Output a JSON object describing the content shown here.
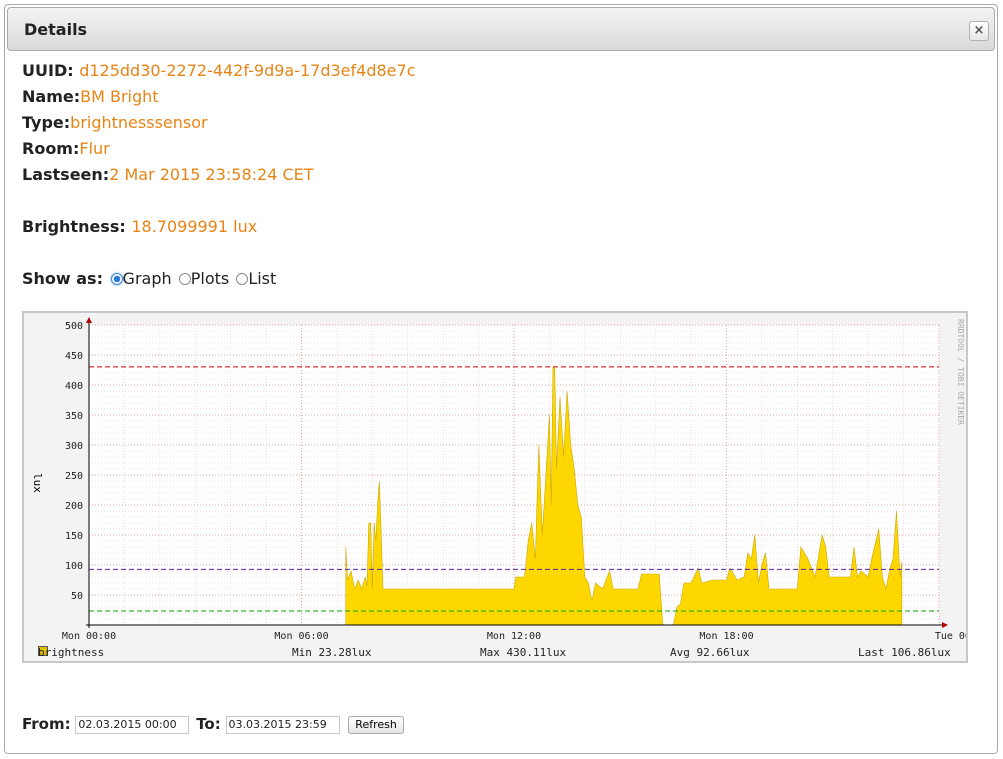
{
  "dialog": {
    "title": "Details",
    "close_label": "×"
  },
  "fields": [
    {
      "label": "UUID: ",
      "value": "d125dd30-2272-442f-9d9a-17d3ef4d8e7c"
    },
    {
      "label": "Name:",
      "value": "BM Bright"
    },
    {
      "label": "Type:",
      "value": "brightnesssensor"
    },
    {
      "label": "Room:",
      "value": "Flur"
    },
    {
      "label": "Lastseen:",
      "value": "2 Mar 2015 23:58:24 CET"
    }
  ],
  "brightness": {
    "label": "Brightness: ",
    "value": "18.7099991 lux"
  },
  "show_as": {
    "label": "Show as: ",
    "options": [
      "Graph",
      "Plots",
      "List"
    ],
    "selected": "Graph"
  },
  "colors": {
    "accent": "#e88415",
    "area": "#ffd700",
    "max_line": "#cc0000",
    "avg_line": "#5522aa",
    "min_line": "#00aa00"
  },
  "chart_data": {
    "type": "area",
    "ylabel": "lux",
    "watermark": "RRDTOOL / TOBI OETIKER",
    "ylim": [
      0,
      500
    ],
    "yticks": [
      50,
      100,
      150,
      200,
      250,
      300,
      350,
      400,
      450,
      500
    ],
    "xlim": [
      0,
      24
    ],
    "xticks": [
      {
        "x": 0,
        "label": "Mon 00:00"
      },
      {
        "x": 6,
        "label": "Mon 06:00"
      },
      {
        "x": 12,
        "label": "Mon 12:00"
      },
      {
        "x": 18,
        "label": "Mon 18:00"
      },
      {
        "x": 24,
        "label": "Tue 00:00"
      }
    ],
    "hlines": {
      "max": 430.11,
      "avg": 92.66,
      "min": 23.28
    },
    "legend": {
      "series": "brightness",
      "min": "Min  23.28lux",
      "max": "Max 430.11lux",
      "avg": "Avg  92.66lux",
      "last": "Last 106.86lux"
    },
    "series": [
      {
        "name": "brightness",
        "points": [
          [
            0,
            0
          ],
          [
            7.25,
            0
          ],
          [
            7.25,
            130
          ],
          [
            7.3,
            75
          ],
          [
            7.4,
            90
          ],
          [
            7.5,
            60
          ],
          [
            7.6,
            75
          ],
          [
            7.7,
            60
          ],
          [
            7.8,
            80
          ],
          [
            7.85,
            65
          ],
          [
            7.9,
            170
          ],
          [
            7.95,
            170
          ],
          [
            8.0,
            60
          ],
          [
            8.05,
            170
          ],
          [
            8.1,
            140
          ],
          [
            8.15,
            200
          ],
          [
            8.2,
            240
          ],
          [
            8.25,
            150
          ],
          [
            8.3,
            60
          ],
          [
            9.0,
            60
          ],
          [
            10.5,
            60
          ],
          [
            12.0,
            60
          ],
          [
            12.05,
            80
          ],
          [
            12.3,
            80
          ],
          [
            12.4,
            140
          ],
          [
            12.5,
            170
          ],
          [
            12.6,
            110
          ],
          [
            12.7,
            300
          ],
          [
            12.8,
            150
          ],
          [
            12.9,
            250
          ],
          [
            13.0,
            350
          ],
          [
            13.05,
            200
          ],
          [
            13.1,
            430
          ],
          [
            13.15,
            430
          ],
          [
            13.2,
            260
          ],
          [
            13.3,
            380
          ],
          [
            13.4,
            280
          ],
          [
            13.5,
            390
          ],
          [
            13.6,
            300
          ],
          [
            13.7,
            260
          ],
          [
            13.8,
            200
          ],
          [
            13.9,
            180
          ],
          [
            14.0,
            80
          ],
          [
            14.1,
            70
          ],
          [
            14.2,
            40
          ],
          [
            14.3,
            70
          ],
          [
            14.5,
            60
          ],
          [
            14.6,
            75
          ],
          [
            14.7,
            90
          ],
          [
            14.8,
            60
          ],
          [
            15.0,
            60
          ],
          [
            15.5,
            60
          ],
          [
            15.6,
            85
          ],
          [
            16.0,
            85
          ],
          [
            16.1,
            85
          ],
          [
            16.2,
            0
          ],
          [
            16.5,
            0
          ],
          [
            16.6,
            30
          ],
          [
            16.7,
            35
          ],
          [
            16.8,
            70
          ],
          [
            17.0,
            70
          ],
          [
            17.2,
            95
          ],
          [
            17.3,
            70
          ],
          [
            17.6,
            75
          ],
          [
            18.0,
            75
          ],
          [
            18.1,
            95
          ],
          [
            18.3,
            75
          ],
          [
            18.5,
            80
          ],
          [
            18.6,
            120
          ],
          [
            18.7,
            110
          ],
          [
            18.8,
            150
          ],
          [
            18.9,
            70
          ],
          [
            19.0,
            100
          ],
          [
            19.1,
            120
          ],
          [
            19.2,
            60
          ],
          [
            19.5,
            60
          ],
          [
            19.8,
            60
          ],
          [
            20.0,
            60
          ],
          [
            20.1,
            130
          ],
          [
            20.3,
            110
          ],
          [
            20.5,
            80
          ],
          [
            20.7,
            150
          ],
          [
            20.8,
            130
          ],
          [
            20.9,
            80
          ],
          [
            21.0,
            80
          ],
          [
            21.5,
            80
          ],
          [
            21.6,
            130
          ],
          [
            21.7,
            80
          ],
          [
            21.8,
            90
          ],
          [
            22.0,
            80
          ],
          [
            22.1,
            110
          ],
          [
            22.3,
            160
          ],
          [
            22.4,
            80
          ],
          [
            22.5,
            60
          ],
          [
            22.6,
            90
          ],
          [
            22.7,
            110
          ],
          [
            22.8,
            190
          ],
          [
            22.9,
            80
          ],
          [
            22.95,
            106
          ],
          [
            22.95,
            0
          ]
        ]
      }
    ]
  },
  "footer": {
    "from_label": "From:",
    "from_value": "02.03.2015 00:00",
    "to_label": "To:",
    "to_value": "03.03.2015 23:59",
    "refresh_label": "Refresh"
  }
}
